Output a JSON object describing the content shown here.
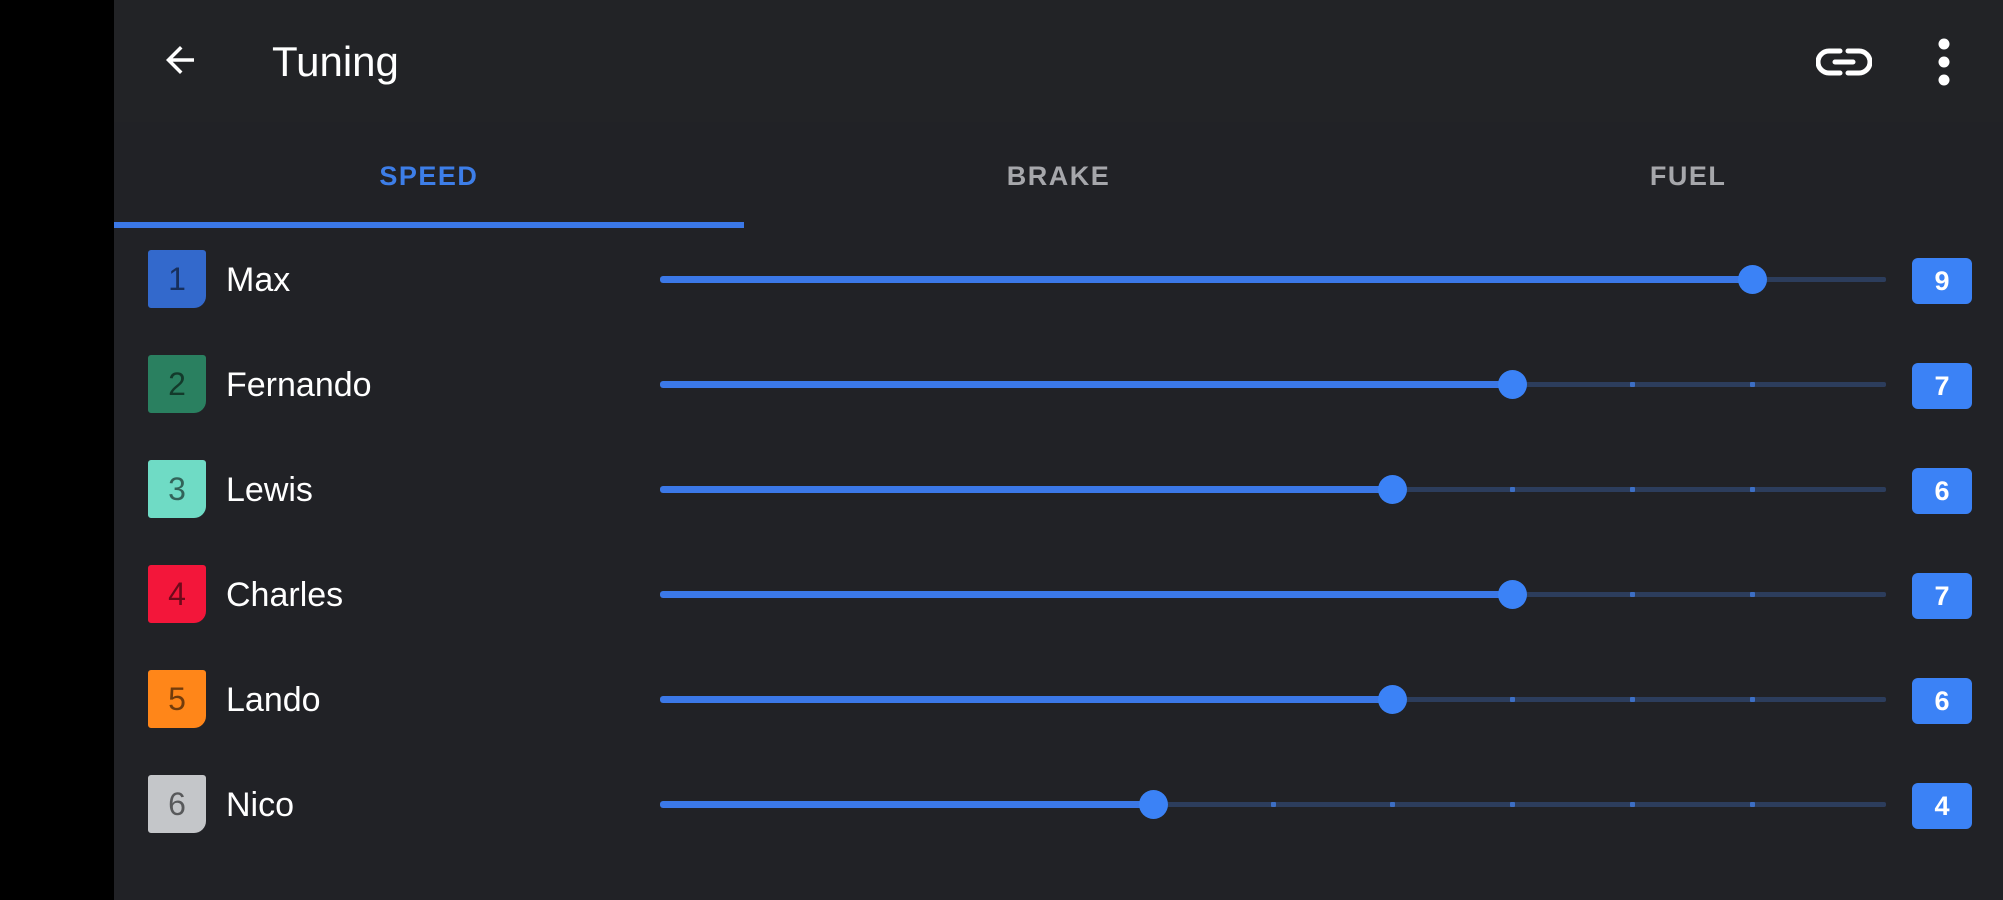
{
  "toolbar": {
    "title": "Tuning",
    "back_icon": "arrow-left-icon",
    "link_icon": "link-icon",
    "more_icon": "more-vertical-icon"
  },
  "tabs": [
    {
      "label": "SPEED",
      "active": true
    },
    {
      "label": "BRAKE",
      "active": false
    },
    {
      "label": "FUEL",
      "active": false
    }
  ],
  "slider_scale": {
    "min": 0,
    "max": 10
  },
  "drivers": [
    {
      "number": "1",
      "name": "Max",
      "value": 9,
      "value_label": "9",
      "color": "#3369cc"
    },
    {
      "number": "2",
      "name": "Fernando",
      "value": 7,
      "value_label": "7",
      "color": "#2a8060"
    },
    {
      "number": "3",
      "name": "Lewis",
      "value": 6,
      "value_label": "6",
      "color": "#6fdbc5"
    },
    {
      "number": "4",
      "name": "Charles",
      "value": 7,
      "value_label": "7",
      "color": "#f3163a"
    },
    {
      "number": "5",
      "name": "Lando",
      "value": 6,
      "value_label": "6",
      "color": "#ff8619"
    },
    {
      "number": "6",
      "name": "Nico",
      "value": 4,
      "value_label": "4",
      "color": "#c4c6c9"
    }
  ],
  "colors": {
    "accent": "#3b82f6",
    "background": "#212226",
    "tab_inactive": "#a6a7ab"
  }
}
